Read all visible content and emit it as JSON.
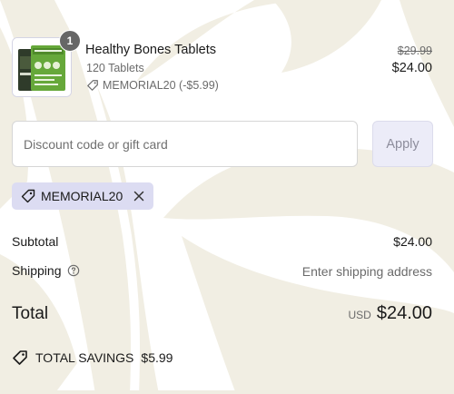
{
  "line_item": {
    "quantity": "1",
    "title": "Healthy Bones Tablets",
    "variant": "120 Tablets",
    "discount_label": "MEMORIAL20 (-$5.99)",
    "original_price": "$29.99",
    "final_price": "$24.00",
    "thumbnail_icon": "product-bottle-icon"
  },
  "discount_form": {
    "placeholder": "Discount code or gift card",
    "value": "",
    "apply_label": "Apply"
  },
  "applied_code": {
    "code": "MEMORIAL20",
    "tag_icon": "tag-icon",
    "remove_icon": "close-icon"
  },
  "summary": {
    "subtotal_label": "Subtotal",
    "subtotal_value": "$24.00",
    "shipping_label": "Shipping",
    "shipping_help_icon": "help-circle-icon",
    "shipping_value": "Enter shipping address",
    "total_label": "Total",
    "currency": "USD",
    "total_value": "$24.00",
    "savings_icon": "savings-tag-icon",
    "savings_label": "TOTAL SAVINGS",
    "savings_value": "$5.99"
  },
  "colors": {
    "background_pattern": "#f0ede2",
    "apply_button_bg": "#ececf8",
    "code_tag_bg": "#dcdcf2",
    "text_primary": "#1a1a1a",
    "text_secondary": "#6b6b6b",
    "quantity_badge_bg": "#666666"
  }
}
